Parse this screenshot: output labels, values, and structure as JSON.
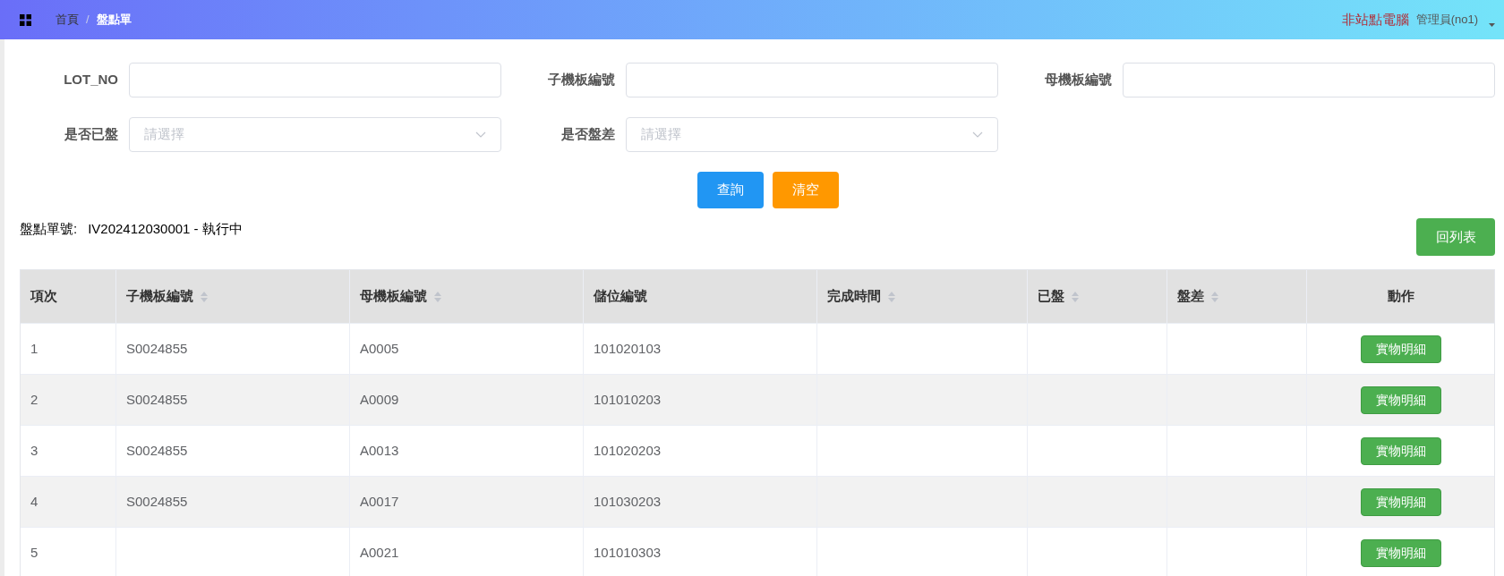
{
  "header": {
    "separator": "/",
    "breadcrumb": [
      {
        "label": "首頁",
        "selected": false
      },
      {
        "label": "盤點單",
        "selected": true
      }
    ],
    "station": "非站點電腦",
    "user": "管理員(no1)"
  },
  "filters": [
    {
      "kind": "text",
      "label": "LOT_NO"
    },
    {
      "kind": "text",
      "label": "子機板編號"
    },
    {
      "kind": "text",
      "label": "母機板編號"
    },
    {
      "kind": "select",
      "label": "是否已盤",
      "placeholder": "請選擇"
    },
    {
      "kind": "select",
      "label": "是否盤差",
      "placeholder": "請選擇"
    }
  ],
  "actions": [
    {
      "label": "查詢",
      "kind": "primary"
    },
    {
      "label": "清空",
      "kind": "warning"
    }
  ],
  "order": {
    "label": "盤點單號:",
    "value": "IV202412030001 - 執行中"
  },
  "back_button": "回列表",
  "table": {
    "columns": [
      {
        "label": "項次",
        "sortable": false
      },
      {
        "label": "子機板編號",
        "sortable": true
      },
      {
        "label": "母機板編號",
        "sortable": true
      },
      {
        "label": "儲位編號",
        "sortable": false
      },
      {
        "label": "完成時間",
        "sortable": true
      },
      {
        "label": "已盤",
        "sortable": true
      },
      {
        "label": "盤差",
        "sortable": true
      },
      {
        "label": "動作",
        "sortable": false
      }
    ],
    "rows": [
      {
        "cells": [
          "1",
          "S0024855",
          "A0005",
          "101020103",
          null,
          null,
          null
        ],
        "action": "實物明細"
      },
      {
        "cells": [
          "2",
          "S0024855",
          "A0009",
          "101010203",
          null,
          null,
          null
        ],
        "action": "實物明細"
      },
      {
        "cells": [
          "3",
          "S0024855",
          "A0013",
          "101020203",
          null,
          null,
          null
        ],
        "action": "實物明細"
      },
      {
        "cells": [
          "4",
          "S0024855",
          "A0017",
          "101030203",
          null,
          null,
          null
        ],
        "action": "實物明細"
      },
      {
        "cells": [
          "5",
          null,
          "A0021",
          "101010303",
          null,
          null,
          null
        ],
        "action": "實物明細"
      }
    ]
  }
}
